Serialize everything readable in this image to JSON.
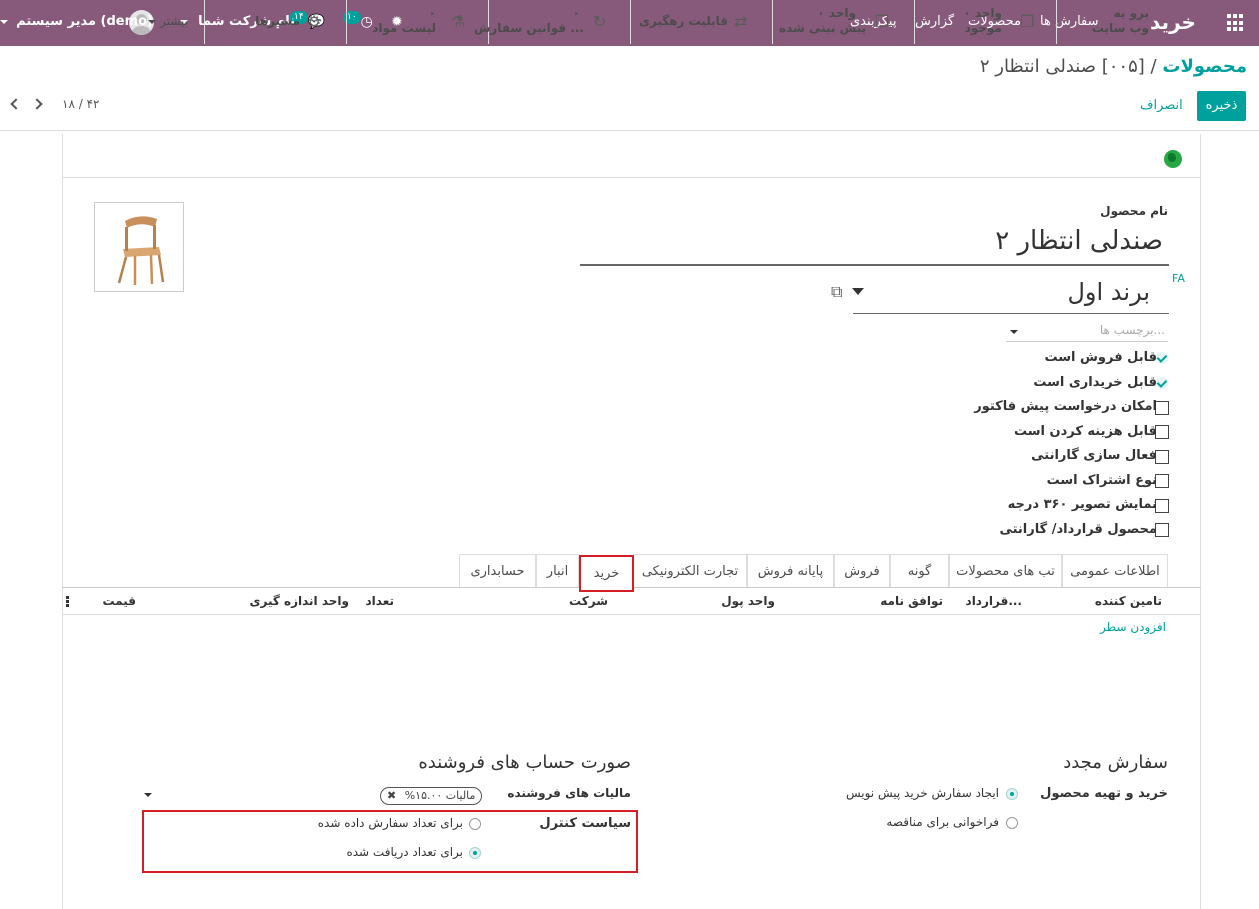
{
  "topbar": {
    "app_name": "خرید",
    "menu": [
      "سفارش ها",
      "محصولات",
      "گزارش",
      "پیکربندی"
    ],
    "activity_count": "۱۰",
    "message_count": "۱۴",
    "company": "نام شرکت شما",
    "user": "مدیر سیستم (demo)",
    "icons": [
      "apps-grid-icon",
      "clock-icon",
      "chat-icon",
      "bug-icon",
      "avatar"
    ],
    "color": "#875a7b"
  },
  "breadcrumb": {
    "parent": "محصولات",
    "separator": "/",
    "current": "[۰۰۵] صندلی انتظار ۲"
  },
  "actions": {
    "save": "ذخیره",
    "discard": "انصراف"
  },
  "pager": {
    "value": "۱۸ / ۴۲"
  },
  "smart_buttons": {
    "website_l1": "برو به",
    "website_l2": "وب سایت",
    "onhand_l1": "۰ واحد",
    "onhand_l2": "موجود",
    "forecast_l1": "۰ واحد",
    "forecast_l2": "پیش بینی شده",
    "traceability": "قابلیت رهگیری",
    "reorder_l1": "۰",
    "reorder_l2": "قوانین سفارش ...",
    "bom_l1": "۰",
    "bom_l2": "لیست مواد",
    "routes": "مسیرها",
    "more": "بیشتر"
  },
  "form": {
    "name_label": "نام محصول",
    "name": "صندلی انتظار ۲",
    "lang": "FA",
    "brand": "برند اول",
    "tags_placeholder": "برچسب ها...",
    "checkboxes": [
      {
        "label": "قابل فروش است",
        "checked": true
      },
      {
        "label": "قابل خریداری است",
        "checked": true
      },
      {
        "label": "امکان درخواست پیش فاکتور",
        "checked": false
      },
      {
        "label": "قابل هزینه کردن است",
        "checked": false
      },
      {
        "label": "فعال سازی گارانتی",
        "checked": false
      },
      {
        "label": "نوع اشتراک است",
        "checked": false
      },
      {
        "label": "نمایش تصویر ۳۶۰ درجه",
        "checked": false
      },
      {
        "label": "محصول قرارداد/ گارانتی",
        "checked": false
      }
    ]
  },
  "tabs": [
    "اطلاعات عمومی",
    "تب های محصولات",
    "گونه",
    "فروش",
    "پایانه فروش",
    "تجارت الکترونیکی",
    "خرید",
    "انبار",
    "حسابداری"
  ],
  "active_tab": "خرید",
  "vendor_table": {
    "columns": [
      "تامین کننده",
      "قرارداد...",
      "توافق نامه",
      "واحد پول",
      "شرکت",
      "تعداد",
      "واحد اندازه گیری",
      "قیمت"
    ],
    "add_line": "افزودن سطر"
  },
  "reorder": {
    "title": "سفارش مجدد",
    "field_label": "خرید و تهیه محصول",
    "options": [
      {
        "label": "ایجاد سفارش خرید پیش نویس",
        "selected": true
      },
      {
        "label": "فراخوانی برای مناقصه",
        "selected": false
      }
    ]
  },
  "vendor_bills": {
    "title": "صورت حساب های فروشنده",
    "tax_label": "مالیات های فروشنده",
    "tax_tag": "مالیات ۱۵.۰۰%",
    "control_label": "سیاست کنترل",
    "options": [
      {
        "label": "برای تعداد سفارش داده شده",
        "selected": false
      },
      {
        "label": "برای تعداد دریافت شده",
        "selected": true
      }
    ]
  }
}
